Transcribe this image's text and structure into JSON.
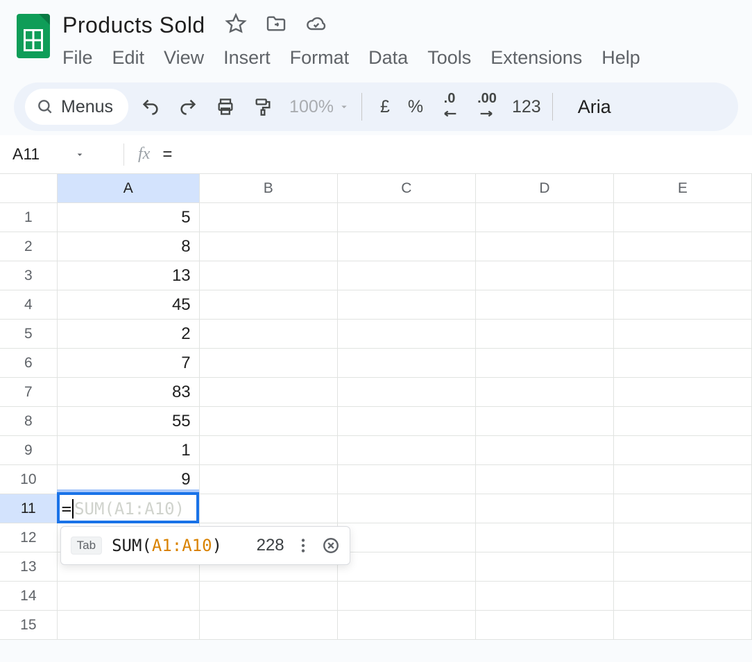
{
  "header": {
    "doc_title": "Products Sold"
  },
  "menus": {
    "file": "File",
    "edit": "Edit",
    "view": "View",
    "insert": "Insert",
    "format": "Format",
    "data": "Data",
    "tools": "Tools",
    "extensions": "Extensions",
    "help": "Help"
  },
  "toolbar": {
    "menus_label": "Menus",
    "zoom_label": "100%",
    "currency_label": "£",
    "percent_label": "%",
    "dec_decrease_label": ".0",
    "dec_increase_label": ".00",
    "num_format_label": "123",
    "font_label": "Aria"
  },
  "formula_bar": {
    "name_box": "A11",
    "fx_label": "fx",
    "formula_text": "="
  },
  "columns": [
    "A",
    "B",
    "C",
    "D",
    "E"
  ],
  "rows": [
    "1",
    "2",
    "3",
    "4",
    "5",
    "6",
    "7",
    "8",
    "9",
    "10",
    "11",
    "12",
    "13",
    "14",
    "15"
  ],
  "cells": {
    "A": [
      "5",
      "8",
      "13",
      "45",
      "2",
      "7",
      "83",
      "55",
      "1",
      "9",
      "",
      "",
      "",
      "",
      ""
    ]
  },
  "active": {
    "cell": "A11",
    "typed_prefix": "=",
    "ghost_suggestion": "SUM(A1:A10)"
  },
  "autocomplete": {
    "tab_hint": "Tab",
    "fn": "SUM",
    "range": "A1:A10",
    "result": "228"
  }
}
